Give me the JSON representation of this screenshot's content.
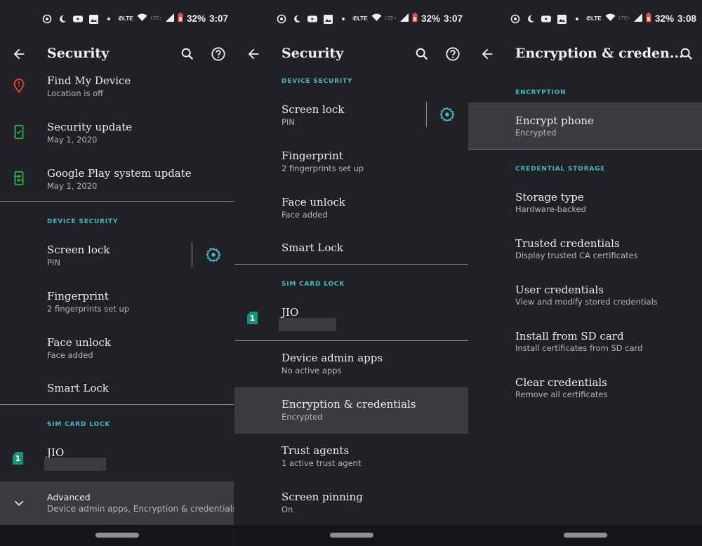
{
  "colors": {
    "background": "#202124",
    "accent": "#4fb3c4",
    "highlight": "#3b3c3f",
    "find_device_red": "#e8453c",
    "update_green": "#34a853",
    "sim_teal": "#1b8f7a"
  },
  "panels": [
    {
      "status": {
        "battery": "32%",
        "time": "3:07",
        "notif_icons": [
          "whatsapp-icon",
          "night-mode-icon",
          "youtube-icon",
          "gallery-icon",
          "dot-icon"
        ],
        "network": [
          "volte-call-icon",
          "wifi-icon",
          "lte-plus-icon",
          "signal-icon",
          "battery-icon"
        ],
        "lte_label": "LTE",
        "lte_plus_label": "LTE+"
      },
      "appbar": {
        "title": "Security",
        "back": "back-icon",
        "actions": [
          "search-icon",
          "help-icon"
        ]
      },
      "items": {
        "find_my_device": {
          "title": "Find My Device",
          "summary": "Location is off",
          "icon": "location-alert-icon"
        },
        "security_update": {
          "title": "Security update",
          "summary": "May 1, 2020",
          "icon": "phone-check-icon"
        },
        "play_update": {
          "title": "Google Play system update",
          "summary": "May 1, 2020",
          "icon": "phone-sync-icon"
        },
        "device_security_header": "DEVICE SECURITY",
        "screen_lock": {
          "title": "Screen lock",
          "summary": "PIN",
          "settings_icon": "gear-icon"
        },
        "fingerprint": {
          "title": "Fingerprint",
          "summary": "2 fingerprints set up"
        },
        "face_unlock": {
          "title": "Face unlock",
          "summary": "Face added"
        },
        "smart_lock": {
          "title": "Smart Lock"
        },
        "sim_header": "SIM CARD LOCK",
        "jio": {
          "title": "JIO",
          "sim_number": "1"
        },
        "advanced": {
          "title": "Advanced",
          "summary": "Device admin apps, Encryption & credentials,..",
          "icon": "chevron-down-icon"
        }
      }
    },
    {
      "status": {
        "battery": "32%",
        "time": "3:07",
        "lte_label": "LTE",
        "lte_plus_label": "LTE+"
      },
      "appbar": {
        "title": "Security"
      },
      "items": {
        "device_security_header": "DEVICE SECURITY",
        "screen_lock": {
          "title": "Screen lock",
          "summary": "PIN"
        },
        "fingerprint": {
          "title": "Fingerprint",
          "summary": "2 fingerprints set up"
        },
        "face_unlock": {
          "title": "Face unlock",
          "summary": "Face added"
        },
        "smart_lock": {
          "title": "Smart Lock"
        },
        "sim_header": "SIM CARD LOCK",
        "jio": {
          "title": "JIO",
          "sim_number": "1"
        },
        "device_admin": {
          "title": "Device admin apps",
          "summary": "No active apps"
        },
        "encryption": {
          "title": "Encryption & credentials",
          "summary": "Encrypted"
        },
        "trust_agents": {
          "title": "Trust agents",
          "summary": "1 active trust agent"
        },
        "screen_pinning": {
          "title": "Screen pinning",
          "summary": "On"
        }
      }
    },
    {
      "status": {
        "battery": "32%",
        "time": "3:08",
        "lte_label": "LTE",
        "lte_plus_label": "LTE+"
      },
      "appbar": {
        "title": "Encryption & creden..."
      },
      "items": {
        "encryption_header": "ENCRYPTION",
        "encrypt_phone": {
          "title": "Encrypt phone",
          "summary": "Encrypted"
        },
        "credential_header": "CREDENTIAL STORAGE",
        "storage_type": {
          "title": "Storage type",
          "summary": "Hardware-backed"
        },
        "trusted_credentials": {
          "title": "Trusted credentials",
          "summary": "Display trusted CA certificates"
        },
        "user_credentials": {
          "title": "User credentials",
          "summary": "View and modify stored credentials"
        },
        "install_sd": {
          "title": "Install from SD card",
          "summary": "Install certificates from SD card"
        },
        "clear_credentials": {
          "title": "Clear credentials",
          "summary": "Remove all certificates"
        }
      }
    }
  ]
}
